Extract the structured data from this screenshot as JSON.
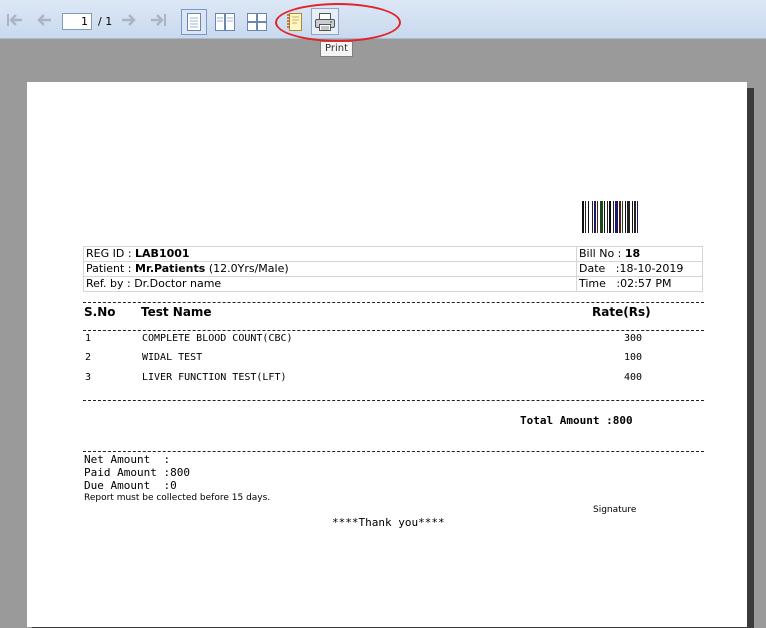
{
  "toolbar": {
    "page_current": "1",
    "page_total": "/ 1",
    "tooltip": "Print"
  },
  "report": {
    "reg_label": "REG ID :",
    "reg_value": "LAB1001",
    "patient_label": "Patient :",
    "patient_name": "Mr.Patients",
    "patient_meta": "(12.0Yrs/Male)",
    "ref_label": "Ref. by :",
    "ref_value": "Dr.Doctor name",
    "bill_label": "Bill No :",
    "bill_value": "18",
    "date_label": "Date",
    "date_value": ":18-10-2019",
    "time_label": "Time",
    "time_value": ":02:57 PM",
    "columns": {
      "sno": "S.No",
      "test": "Test Name",
      "rate": "Rate(Rs)"
    },
    "tests": [
      {
        "sno": "1",
        "name": "COMPLETE BLOOD COUNT(CBC)",
        "rate": "300"
      },
      {
        "sno": "2",
        "name": "WIDAL TEST",
        "rate": "100"
      },
      {
        "sno": "3",
        "name": "LIVER FUNCTION TEST(LFT)",
        "rate": "400"
      }
    ],
    "total": "Total Amount :800",
    "net_amount": "Net Amount  :",
    "paid_amount": "Paid Amount :800",
    "due_amount": "Due Amount  :0",
    "note": "Report must be collected before 15 days.",
    "signature": "Signature",
    "thanks": "****Thank you****"
  },
  "colors": {
    "highlight": "#e0242a",
    "toolbar": "#c9d9ee"
  }
}
